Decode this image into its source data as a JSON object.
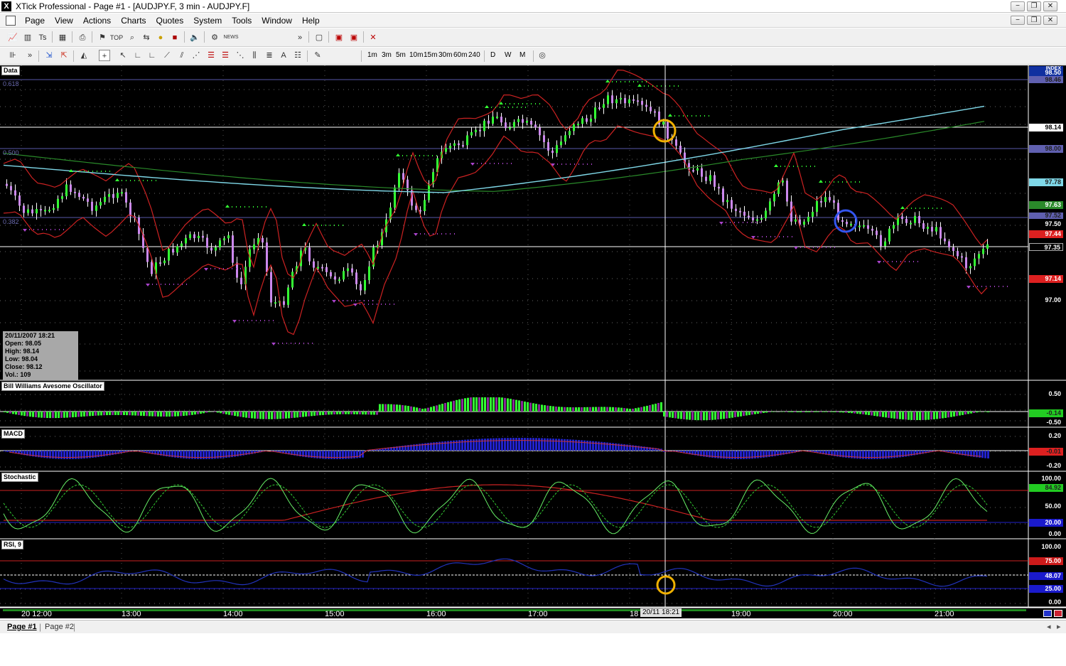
{
  "window": {
    "title": "XTick Professional - Page #1 - [AUDJPY.F, 3 min - AUDJPY.F]",
    "icon_glyph": "X",
    "min_glyph": "−",
    "max_glyph": "❐",
    "close_glyph": "✕"
  },
  "menu": [
    "Page",
    "View",
    "Actions",
    "Charts",
    "Quotes",
    "System",
    "Tools",
    "Window",
    "Help"
  ],
  "timeframes": [
    "1m",
    "3m",
    "5m",
    "10m",
    "15m",
    "30m",
    "60m",
    "240",
    "D",
    "W",
    "M"
  ],
  "toolbar_top_label": "TOP",
  "toolbar_news_label": "NEWS",
  "panes": {
    "main": "Data",
    "ao": "Bill Williams Avesome Oscillator",
    "macd": "MACD",
    "stoch": "Stochastic",
    "rsi": "RSI, 9"
  },
  "info_box": {
    "date": "20/11/2007 18:21",
    "open": "Open: 98.05",
    "high": "High: 98.14",
    "low": "Low: 98.04",
    "close": "Close: 98.12",
    "vol": "Vol.: 109"
  },
  "fib_labels": [
    "0.618",
    "0.500",
    "0.382"
  ],
  "price_axis": {
    "index_label": "INDEX",
    "p1": "98.50",
    "p2": "98.46",
    "p3": "98.14",
    "p4": "98.00",
    "p5": "97.78",
    "p6": "97.63",
    "p7": "97.52",
    "p8": "97.50",
    "p9": "97.44",
    "p10": "97.35",
    "p11": "97.14",
    "p12": "97.00"
  },
  "ao_axis": {
    "a": "0.50",
    "b": "-0.14",
    "c": "-0.50"
  },
  "macd_axis": {
    "a": "0.20",
    "b": "-0.01",
    "c": "-0.20"
  },
  "stoch_axis": {
    "a": "100.00",
    "b": "84.92",
    "c": "50.00",
    "d": "20.00",
    "e": "0.00"
  },
  "rsi_axis": {
    "a": "100.00",
    "b": "75.00",
    "c": "48.07",
    "d": "25.00",
    "e": "0.00"
  },
  "time_axis": [
    "20 12:00",
    "13:00",
    "14:00",
    "15:00",
    "16:00",
    "17:00",
    "18",
    "19:00",
    "20:00",
    "21:00"
  ],
  "cursor_time": "20/11 18:21",
  "pages": [
    "Page #1",
    "Page #2"
  ],
  "colors": {
    "background": "#000000",
    "bull": "#33ff33",
    "bear": "#cc88ee",
    "bollinger": "#cc2222",
    "ma_cyan": "#7fd8e8",
    "ma_green": "#2a8a2a",
    "macd_hist": "#2222cc",
    "rsi_line": "#2233bb",
    "highlight_orange": "#f0b000",
    "highlight_blue": "#3355ee"
  }
}
